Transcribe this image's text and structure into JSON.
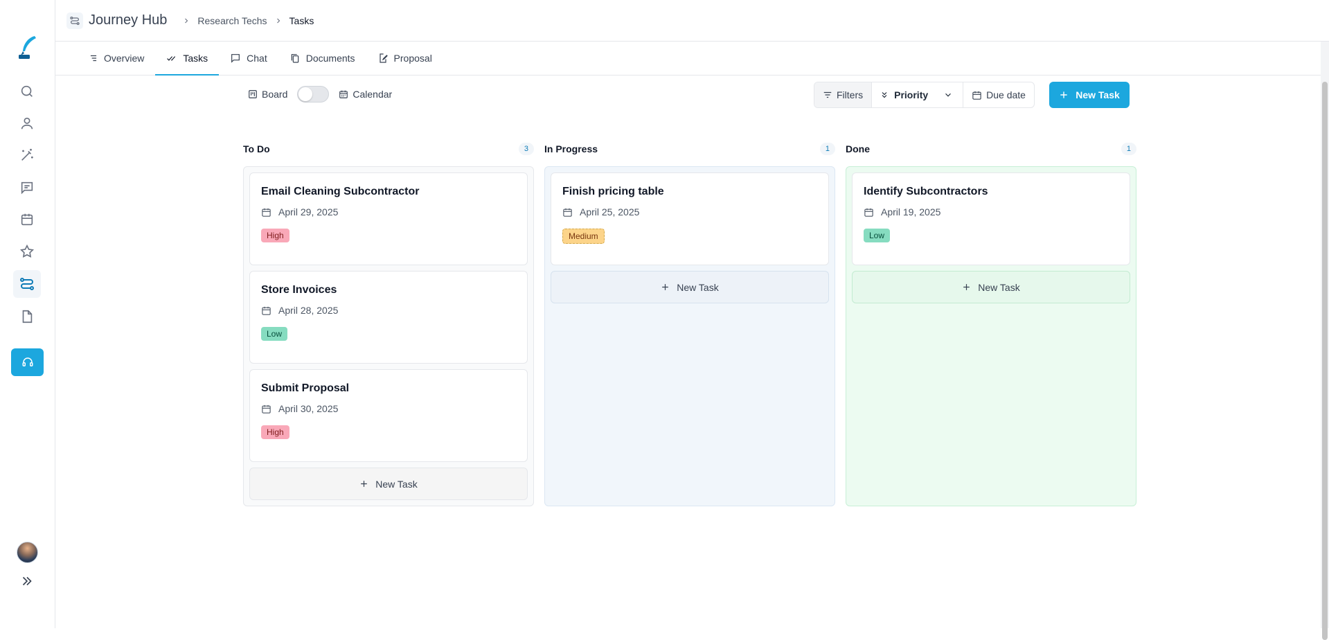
{
  "header": {
    "title": "Journey Hub",
    "breadcrumb": [
      "Research Techs",
      "Tasks"
    ]
  },
  "tabs": [
    {
      "label": "Overview",
      "icon": "list-icon"
    },
    {
      "label": "Tasks",
      "icon": "double-check-icon",
      "active": true
    },
    {
      "label": "Chat",
      "icon": "chat-bubble-icon"
    },
    {
      "label": "Documents",
      "icon": "copy-icon"
    },
    {
      "label": "Proposal",
      "icon": "edit-document-icon"
    }
  ],
  "sidebar": {
    "items": [
      "search-icon",
      "user-icon",
      "magic-wand-icon",
      "message-icon",
      "calendar-icon",
      "star-icon",
      "journey-icon",
      "document-icon"
    ],
    "active": "journey-icon"
  },
  "toolbar": {
    "board_label": "Board",
    "calendar_label": "Calendar",
    "filters_label": "Filters",
    "priority_label": "Priority",
    "due_date_label": "Due date",
    "new_task_label": "New Task"
  },
  "columns": [
    {
      "title": "To Do",
      "count": "3",
      "cards": [
        {
          "title": "Email Cleaning Subcontractor",
          "date": "April 29, 2025",
          "priority": "High"
        },
        {
          "title": "Store Invoices",
          "date": "April 28, 2025",
          "priority": "Low"
        },
        {
          "title": "Submit Proposal",
          "date": "April 30, 2025",
          "priority": "High"
        }
      ],
      "add_label": "New Task"
    },
    {
      "title": "In Progress",
      "count": "1",
      "cards": [
        {
          "title": "Finish pricing table",
          "date": "April 25, 2025",
          "priority": "Medium"
        }
      ],
      "add_label": "New Task"
    },
    {
      "title": "Done",
      "count": "1",
      "cards": [
        {
          "title": "Identify Subcontractors",
          "date": "April 19, 2025",
          "priority": "Low"
        }
      ],
      "add_label": "New Task"
    }
  ],
  "colors": {
    "accent": "#1ca7de",
    "high": "#f9a8b8",
    "low": "#86dcc0",
    "medium": "#fcd48a"
  }
}
